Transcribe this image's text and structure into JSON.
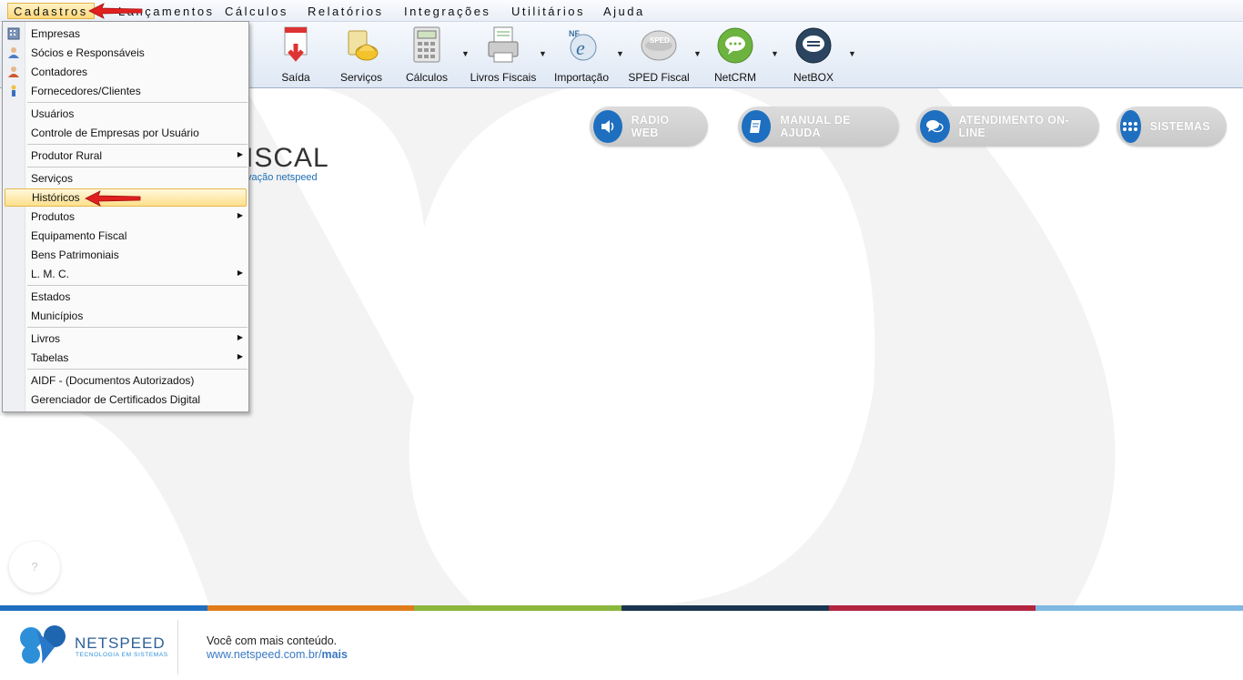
{
  "menubar": {
    "items": [
      "Cadastros",
      "Lançamentos",
      "Cálculos",
      "Relatórios",
      "Integrações",
      "Utilitários",
      "Ajuda"
    ]
  },
  "toolbar": {
    "buttons": [
      "Saída",
      "Serviços",
      "Cálculos",
      "Livros Fiscais",
      "Importação",
      "SPED Fiscal",
      "NetCRM",
      "NetBOX"
    ]
  },
  "icons": {
    "nfe_text": "NF",
    "sped_text": "SPED"
  },
  "brand": {
    "title": "ISCAL",
    "subtitle": "vação netspeed"
  },
  "actions": {
    "radio": "RÁDIO WEB",
    "manual": "MANUAL DE AJUDA",
    "atendimento": "ATENDIMENTO ON-LINE",
    "sistemas": "SISTEMAS"
  },
  "help_button": "?",
  "dropdown": {
    "items": [
      "Empresas",
      "Sócios e Responsáveis",
      "Contadores",
      "Fornecedores/Clientes",
      "Usuários",
      "Controle de Empresas por Usuário",
      "Produtor Rural",
      "Serviços",
      "Históricos",
      "Produtos",
      "Equipamento Fiscal",
      "Bens Patrimoniais",
      "L. M. C.",
      "Estados",
      "Municípios",
      "Livros",
      "Tabelas",
      "AIDF - (Documentos Autorizados)",
      "Gerenciador de Certificados Digital"
    ],
    "highlighted": "Históricos"
  },
  "footer": {
    "logo_text": "NETSPEED",
    "logo_sub": "TECNOLOGIA EM SISTEMAS",
    "line1": "Você com mais conteúdo.",
    "line2_prefix": "www.netspeed.com.br/",
    "line2_bold": "mais"
  },
  "colors": {
    "accent": "#1e6fbf",
    "stripe": [
      "#1e6fbf",
      "#e07b1a",
      "#8cb63c",
      "#1a3550",
      "#b3243f",
      "#7eb8e3"
    ]
  }
}
